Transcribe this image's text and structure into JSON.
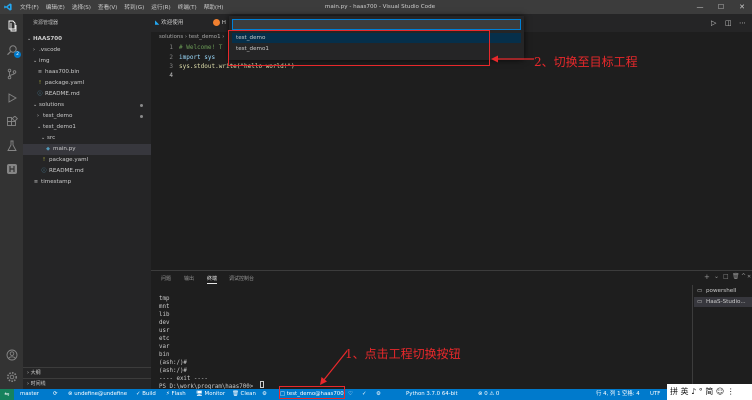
{
  "titlebar": {
    "menu": [
      "文件(F)",
      "编辑(E)",
      "选择(S)",
      "查看(V)",
      "转到(G)",
      "运行(R)",
      "终端(T)",
      "帮助(H)"
    ],
    "title": "main.py - haas700 - Visual Studio Code",
    "minimize": "—",
    "maximize": "☐",
    "close": "✕"
  },
  "sidebar": {
    "header": "资源管理器",
    "items": [
      {
        "label": "HAAS700",
        "arrow": "⌄",
        "icon": "",
        "type": "root"
      },
      {
        "label": ".vscode",
        "arrow": "›",
        "icon": "",
        "type": "folder"
      },
      {
        "label": "img",
        "arrow": "⌄",
        "icon": "",
        "type": "folder"
      },
      {
        "label": "haas700.bin",
        "arrow": "",
        "icon": "≡",
        "type": "file"
      },
      {
        "label": "package.yaml",
        "arrow": "",
        "icon": "!",
        "type": "file"
      },
      {
        "label": "README.md",
        "arrow": "",
        "icon": "ⓘ",
        "type": "file"
      },
      {
        "label": "solutions",
        "arrow": "⌄",
        "icon": "",
        "type": "folder"
      },
      {
        "label": "test_demo",
        "arrow": "›",
        "icon": "",
        "type": "folder"
      },
      {
        "label": "test_demo1",
        "arrow": "⌄",
        "icon": "",
        "type": "folder"
      },
      {
        "label": "src",
        "arrow": "⌄",
        "icon": "",
        "type": "folder"
      },
      {
        "label": "main.py",
        "arrow": "",
        "icon": "◆",
        "type": "file"
      },
      {
        "label": "package.yaml",
        "arrow": "",
        "icon": "!",
        "type": "file"
      },
      {
        "label": "README.md",
        "arrow": "",
        "icon": "ⓘ",
        "type": "file"
      },
      {
        "label": "timestamp",
        "arrow": "",
        "icon": "≡",
        "type": "file"
      }
    ],
    "outline": "大纲",
    "timeline": "时间线"
  },
  "editor": {
    "tabs": [
      {
        "label": "欢迎使用"
      },
      {
        "label": "H"
      }
    ],
    "breadcrumb": "solutions › test_demo1 ›",
    "lines": [
      {
        "n": "1",
        "text": "# Welcome! T"
      },
      {
        "n": "2",
        "text": "import sys"
      },
      {
        "n": "3",
        "text": "sys.stdout.write(\"hello world!\")"
      },
      {
        "n": "4",
        "text": ""
      }
    ]
  },
  "quickpick": {
    "value": "",
    "items": [
      "test_demo",
      "test_demo1"
    ]
  },
  "panel": {
    "tabs": [
      "问题",
      "输出",
      "终端",
      "调试控制台"
    ],
    "terminal_lines": [
      "tmp",
      "mnt",
      "lib",
      "dev",
      "usr",
      "etc",
      "var",
      "bin",
      "(ash:/)#",
      "(ash:/)#",
      "---- exit ----",
      "PS D:\\work\\program\\haas700> "
    ],
    "terminals": [
      "powershell",
      "HaaS-Studio..."
    ],
    "actions": [
      "+",
      "⌄",
      "□",
      "🗑",
      "^",
      "✕"
    ]
  },
  "statusbar": {
    "items": [
      "master",
      "⟳",
      "⊗ undefine@undefine",
      "✓ Build",
      "⚡ Flash",
      "🖥 Monitor",
      "🗑 Clean",
      "⚙",
      "□ test_demo@haas700",
      "♡",
      "✓",
      "⚙",
      "Python 3.7.0 64-bit",
      "⊗ 0 ⚠ 0",
      "行 4, 列 1",
      "空格: 4",
      "UTF"
    ]
  },
  "annotations": {
    "step1": "1、点击工程切换按钮",
    "step2": "2、切换至目标工程"
  },
  "ime": "拼 英 ♪ ° 简 ☺ ⋮",
  "colors": {
    "accent": "#007acc",
    "annotation": "#e8282b",
    "remote": "#16825d"
  }
}
